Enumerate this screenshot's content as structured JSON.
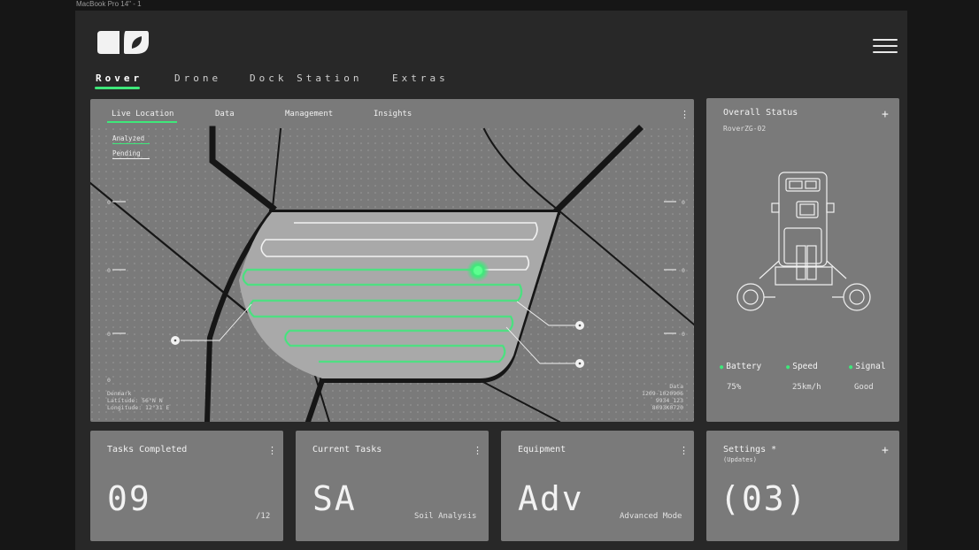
{
  "frame_label": "MacBook Pro 14\" - 1",
  "nav": {
    "tabs": [
      "Rover",
      "Drone",
      "Dock Station",
      "Extras"
    ],
    "active_tab": "Rover"
  },
  "map_panel": {
    "tabs": [
      "Live Location",
      "Data",
      "Management",
      "Insights"
    ],
    "active_tab": "Live Location",
    "legend": [
      "Analyzed",
      "Pending"
    ],
    "location_text": [
      "Denmark",
      "Latitude: 56°N N",
      "Longitude: 12°31 E"
    ],
    "data_text": [
      "Data",
      "1209-1020906",
      "9934_123",
      "8093K0720"
    ],
    "axis_left": [
      "0",
      "0",
      "0"
    ],
    "axis_right": [
      "0",
      "0",
      "0",
      "0"
    ]
  },
  "status": {
    "title": "Overall Status",
    "device": "RoverZG-02",
    "metrics": [
      {
        "label": "Battery",
        "value": "75%"
      },
      {
        "label": "Speed",
        "value": "25km/h"
      },
      {
        "label": "Signal",
        "value": "Good"
      }
    ]
  },
  "cards": {
    "tasks_completed": {
      "title": "Tasks Completed",
      "value": "09",
      "suffix": "/12"
    },
    "current_tasks": {
      "title": "Current Tasks",
      "value": "SA",
      "suffix": "Soil Analysis"
    },
    "equipment": {
      "title": "Equipment",
      "value": "Adv",
      "suffix": "Advanced Mode"
    },
    "settings": {
      "title": "Settings *",
      "note": "(Updates)",
      "value": "(03)"
    }
  },
  "colors": {
    "accent": "#3ee87a",
    "panel": "#7a7a7a",
    "background": "#282828"
  }
}
